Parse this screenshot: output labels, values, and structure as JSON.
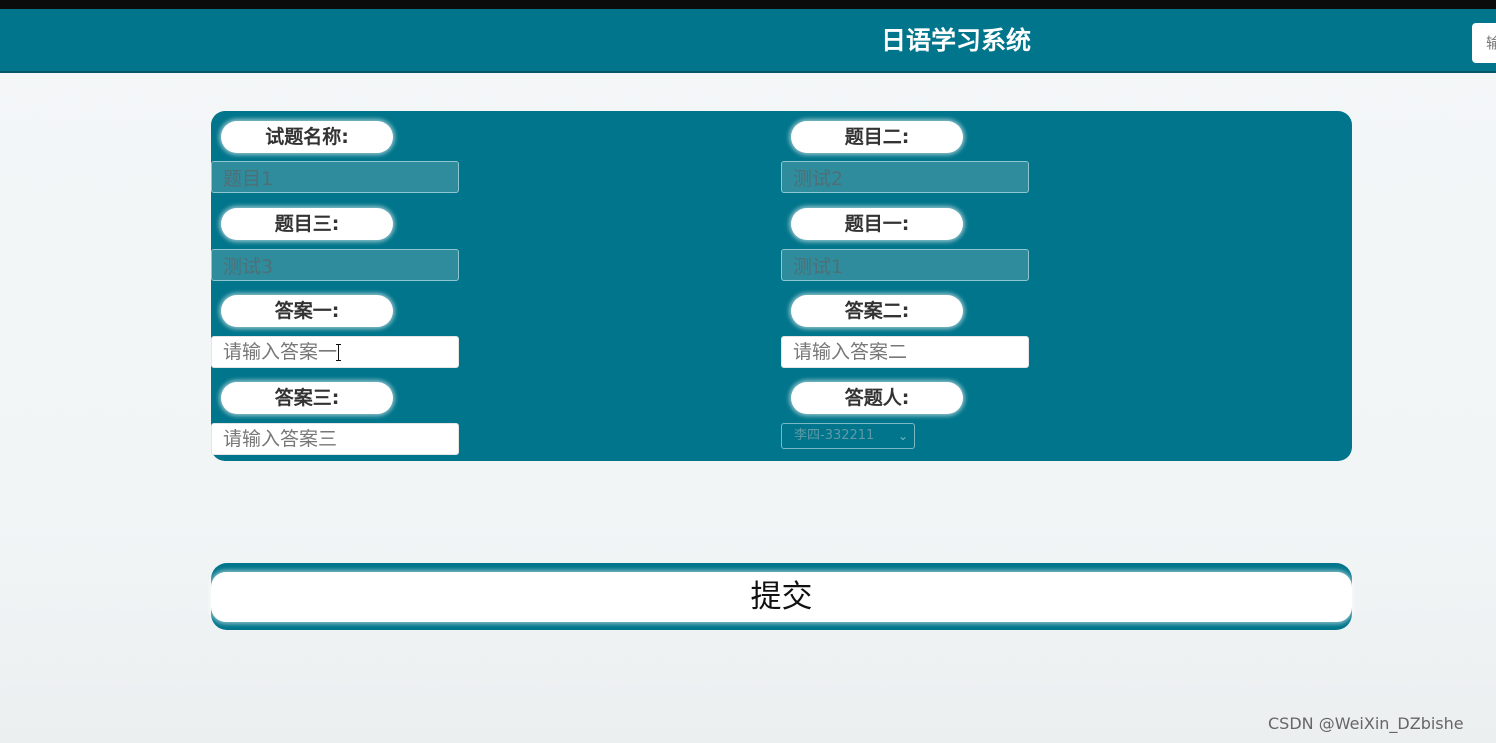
{
  "header": {
    "title": "日语学习系统",
    "search_placeholder": "输"
  },
  "form": {
    "left": [
      {
        "label": "试题名称:",
        "value": "题目1",
        "kind": "readonly"
      },
      {
        "label": "题目三:",
        "value": "测试3",
        "kind": "readonly"
      },
      {
        "label": "答案一:",
        "placeholder": "请输入答案一",
        "kind": "editable"
      },
      {
        "label": "答案三:",
        "placeholder": "请输入答案三",
        "kind": "editable"
      }
    ],
    "right": [
      {
        "label": "题目二:",
        "value": "测试2",
        "kind": "readonly"
      },
      {
        "label": "题目一:",
        "value": "测试1",
        "kind": "readonly"
      },
      {
        "label": "答案二:",
        "placeholder": "请输入答案二",
        "kind": "editable"
      },
      {
        "label": "答题人:",
        "select_value": "李四-332211",
        "kind": "select"
      }
    ]
  },
  "submit": {
    "label": "提交"
  },
  "watermark": "CSDN @WeiXin_DZbishe",
  "colors": {
    "header_bg": "#00758b",
    "panel_bg": "#00758b",
    "page_bg": "#f4f7f8"
  }
}
